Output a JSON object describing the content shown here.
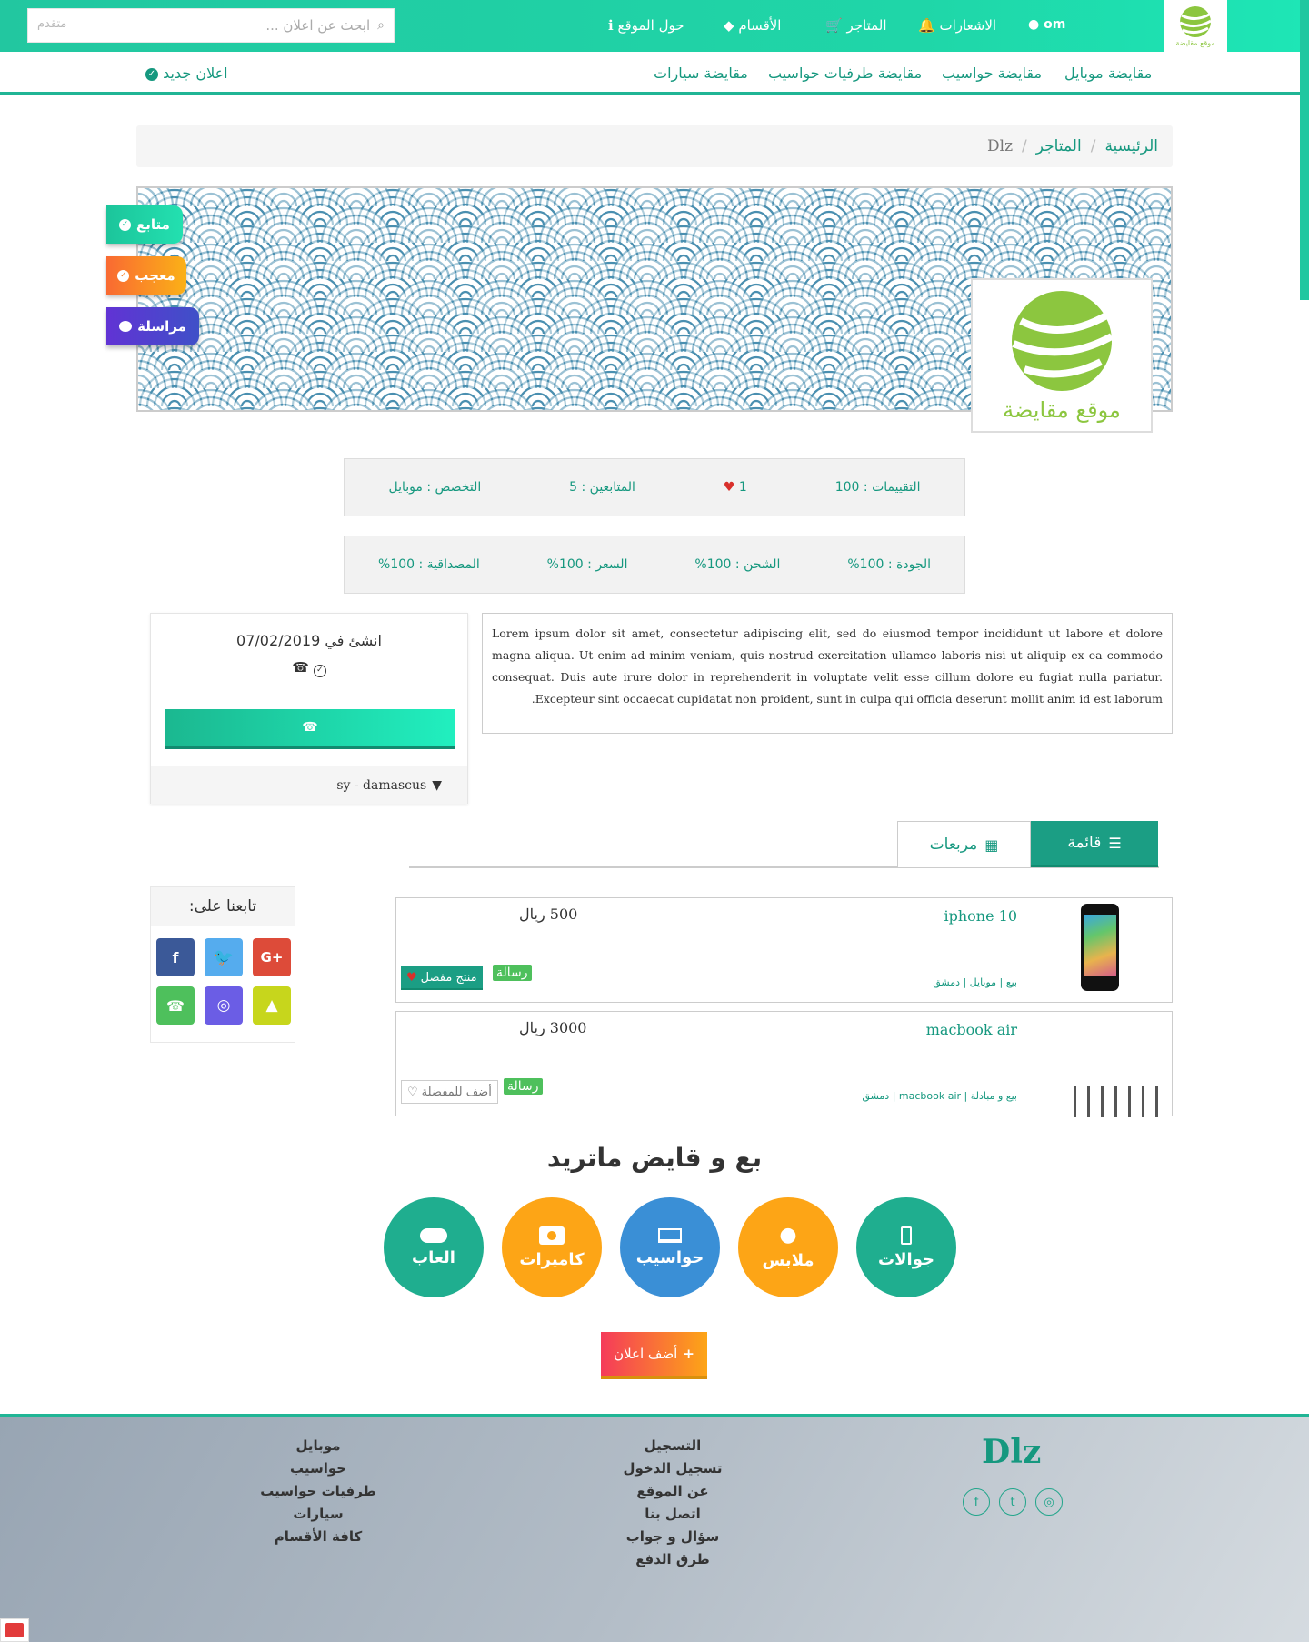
{
  "topbar": {
    "search_placeholder": "ابحث عن اعلان ...",
    "advanced_label": "متقدم",
    "nav": [
      "حول الموقع",
      "الأقسام",
      "المتاجر",
      "الاشعارات",
      "om"
    ],
    "logo_text": "موقع مقايضة"
  },
  "subnav": {
    "items": [
      "مقايضة موبايل",
      "مقايضة حواسيب",
      "مقايضة طرفيات حواسيب",
      "مقايضة سيارات"
    ],
    "new_ad": "اعلان جديد"
  },
  "breadcrumb": [
    "الرئيسية",
    "المتاجر",
    "Dlz"
  ],
  "store": {
    "logo_text": "موقع مقايضة",
    "buttons": {
      "follow": "متابع",
      "like": "معجب",
      "message": "مراسلة"
    }
  },
  "stats_row1": {
    "ratings": "التقييمات : 100",
    "likes": "1",
    "followers": "المتابعين : 5",
    "specialty": "التخصص : موبايل"
  },
  "stats_row2": {
    "quality": "الجودة : 100%",
    "shipping": "الشحن : 100%",
    "price": "السعر : 100%",
    "credibility": "المصداقية : 100%"
  },
  "description": "Lorem ipsum dolor sit amet, consectetur adipiscing elit, sed do eiusmod tempor incididunt ut labore et dolore magna aliqua. Ut enim ad minim veniam, quis nostrud exercitation ullamco laboris nisi ut aliquip ex ea commodo consequat. Duis aute irure dolor in reprehenderit in voluptate velit esse cillum dolore eu fugiat nulla pariatur. Excepteur sint occaecat cupidatat non proident, sunt in culpa qui officia deserunt mollit anim id est laborum.",
  "store_card": {
    "created": "انشئ في 07/02/2019",
    "location": "sy - damascus"
  },
  "tabs": {
    "list": "قائمة",
    "grid": "مربعات"
  },
  "follow_box": {
    "title": "تابعنا على:"
  },
  "products": [
    {
      "title": "iphone 10",
      "price": "500 ريال",
      "meta": "بيع | موبايل | دمشق",
      "message": "رسالة",
      "fav": "منتج مفضل"
    },
    {
      "title": "macbook air",
      "price": "3000 ريال",
      "meta": "بيع و مبادلة | macbook air | دمشق",
      "message": "رسالة",
      "fav": "أضف للمفضلة"
    }
  ],
  "categories_title": "بع و قايض ماتريد",
  "categories": [
    "جوالات",
    "ملابس",
    "حواسيب",
    "كاميرات",
    "العاب"
  ],
  "add_ad": "أضف اعلان",
  "footer": {
    "brand": "Dlz",
    "col1": [
      "التسجيل",
      "تسجيل الدخول",
      "عن الموقع",
      "اتصل بنا",
      "سؤال و جواب",
      "طرق الدفع"
    ],
    "col2": [
      "موبايل",
      "حواسيب",
      "طرفيات حواسيب",
      "سيارات",
      "كافة الأقسام"
    ]
  },
  "colors": {
    "primary": "#20b595",
    "orange": "#fda516",
    "blue": "#3a8fd6",
    "purple": "#5a3fc8"
  }
}
